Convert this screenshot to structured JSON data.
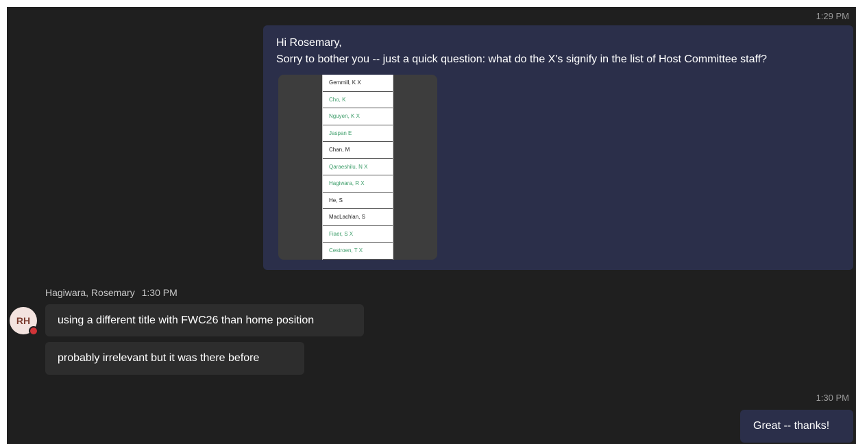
{
  "messages": [
    {
      "direction": "outgoing",
      "time": "1:29 PM",
      "lines": [
        "Hi Rosemary,",
        "Sorry to bother you -- just a quick question: what do the X's signify in the list of Host Committee staff?"
      ],
      "attachment": {
        "rows": [
          {
            "text": "Gemmill, K X",
            "color": "#222222"
          },
          {
            "text": "Cho, K",
            "color": "#3f9e6b"
          },
          {
            "text": "Nguyen, K X",
            "color": "#3f9e6b"
          },
          {
            "text": "Jaspan E",
            "color": "#3f9e6b"
          },
          {
            "text": "Chan, M",
            "color": "#222222"
          },
          {
            "text": "Qaraeshilu, N X",
            "color": "#3f9e6b"
          },
          {
            "text": "Hagiwara, R X",
            "color": "#3f9e6b"
          },
          {
            "text": "He, S",
            "color": "#222222"
          },
          {
            "text": "MacLachlan, S",
            "color": "#222222"
          },
          {
            "text": "Fiaer, S X",
            "color": "#3f9e6b"
          },
          {
            "text": "Cestroen, T X",
            "color": "#3f9e6b"
          }
        ]
      }
    },
    {
      "direction": "incoming",
      "sender": "Hagiwara, Rosemary",
      "time": "1:30 PM",
      "avatar_initials": "RH",
      "presence_color": "#d13438",
      "texts": [
        "using a different title with FWC26 than home position",
        "probably irrelevant but it was there before"
      ]
    },
    {
      "direction": "outgoing",
      "time": "1:30 PM",
      "text": "Great -- thanks!"
    }
  ],
  "colors": {
    "background": "#1f1f1f",
    "outgoing_bubble": "#2b2f4a",
    "incoming_bubble": "#2d2d2d",
    "timestamp": "#9a9a9a"
  }
}
